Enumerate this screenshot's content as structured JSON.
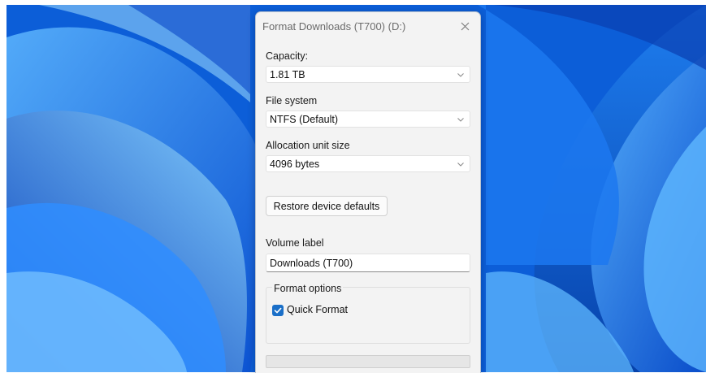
{
  "window": {
    "title": "Format Downloads (T700) (D:)"
  },
  "capacity": {
    "label": "Capacity:",
    "value": "1.81 TB"
  },
  "file_system": {
    "label": "File system",
    "value": "NTFS (Default)"
  },
  "allocation": {
    "label": "Allocation unit size",
    "value": "4096 bytes"
  },
  "restore_button": {
    "label": "Restore device defaults"
  },
  "volume_label": {
    "label": "Volume label",
    "value": "Downloads (T700)"
  },
  "format_options": {
    "title": "Format options",
    "quick_format": {
      "label": "Quick Format",
      "checked": true
    }
  },
  "progress": {
    "value": 0
  },
  "colors": {
    "wallpaper": "#0b63e0",
    "dialog_bg": "#f3f3f3",
    "accent": "#1a6fc8"
  },
  "icons": {
    "close": "close-icon",
    "dropdown": "chevron-down-icon",
    "check": "check-icon"
  }
}
